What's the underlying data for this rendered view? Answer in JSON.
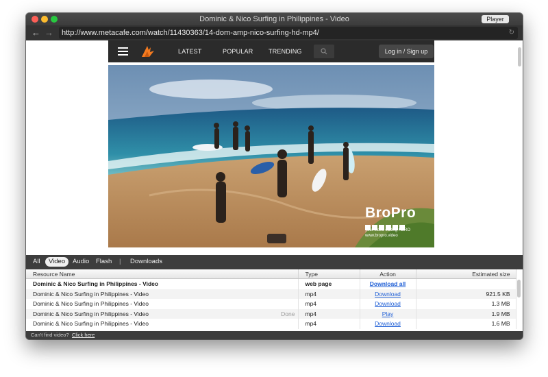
{
  "window": {
    "title": "Dominic & Nico Surfing in Philippines - Video",
    "player_label": "Player"
  },
  "browser": {
    "url": "http://www.metacafe.com/watch/11430363/14-dom-amp-nico-surfing-hd-mp4/"
  },
  "site": {
    "nav": [
      "LATEST",
      "POPULAR",
      "TRENDING"
    ],
    "login_label": "Log in / Sign up",
    "accent_color": "#f47b20",
    "watermark_brand": "BroPro",
    "watermark_tagline": "your video editing HERO",
    "watermark_site": "www.bropro.video"
  },
  "panel": {
    "filters": [
      "All",
      "Video",
      "Audio",
      "Flash",
      "|",
      "Downloads"
    ],
    "active_filter": "Video",
    "columns": [
      "Resource Name",
      "Type",
      "Action",
      "Estimated size"
    ],
    "rows": [
      {
        "name": "Dominic & Nico Surfing in Philippines - Video",
        "status": "",
        "type": "web page",
        "action": "Download all",
        "size": ""
      },
      {
        "name": "Dominic & Nico Surfing in Philippines - Video",
        "status": "",
        "type": "mp4",
        "action": "Download",
        "size": "921.5 KB"
      },
      {
        "name": "Dominic & Nico Surfing in Philippines - Video",
        "status": "",
        "type": "mp4",
        "action": "Download",
        "size": "1.3 MB"
      },
      {
        "name": "Dominic & Nico Surfing in Philippines - Video",
        "status": "Done",
        "type": "mp4",
        "action": "Play",
        "size": "1.9 MB"
      },
      {
        "name": "Dominic & Nico Surfing in Philippines - Video",
        "status": "",
        "type": "mp4",
        "action": "Download",
        "size": "1.6 MB"
      }
    ],
    "footer_text": "Can't find video?",
    "footer_link": "Click here"
  }
}
